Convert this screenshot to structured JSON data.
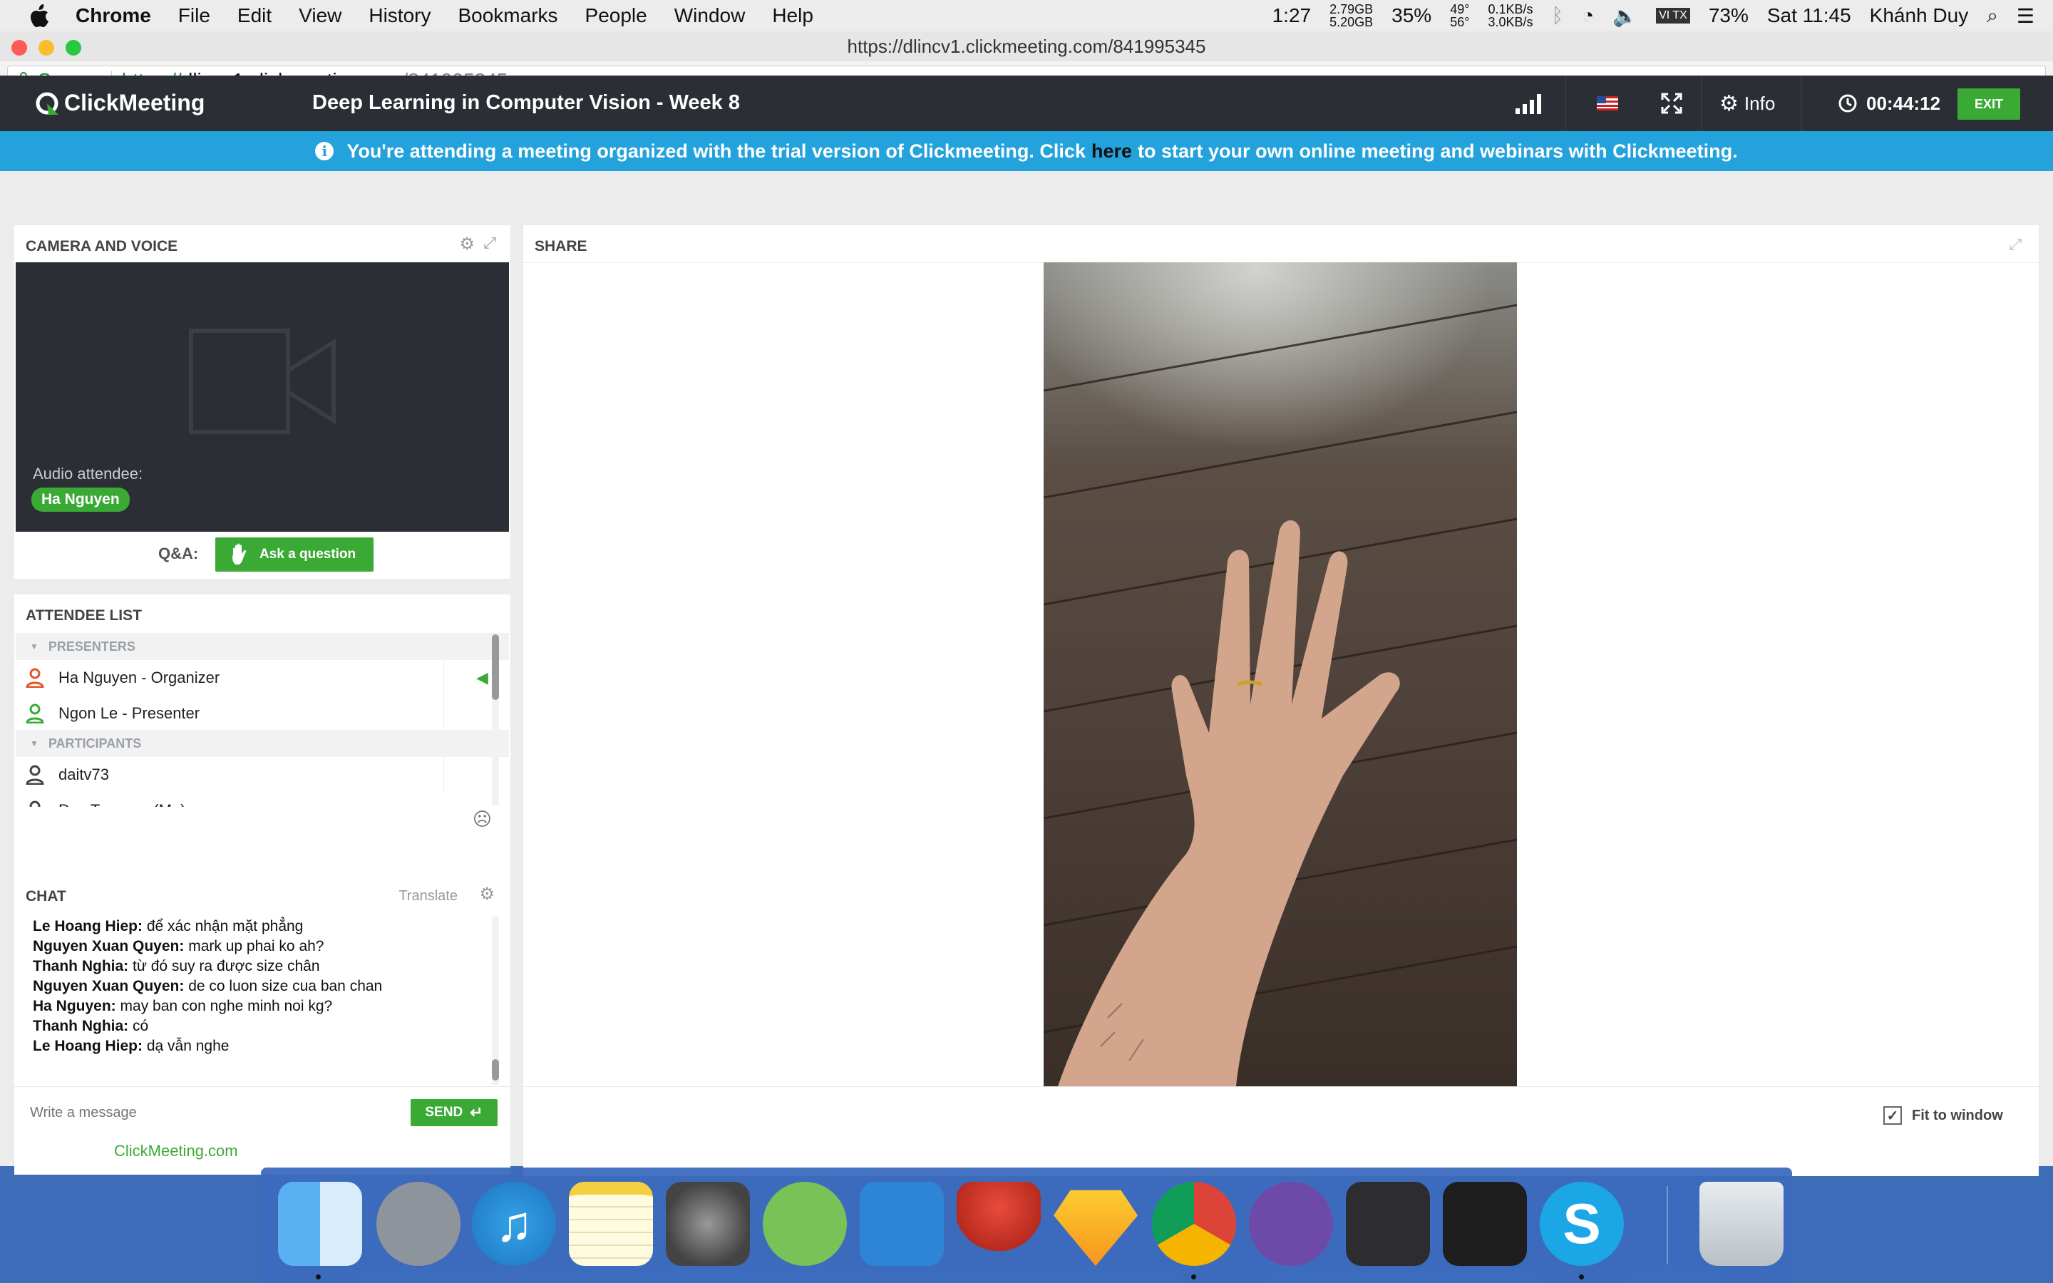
{
  "menubar": {
    "app": "Chrome",
    "items": [
      "File",
      "Edit",
      "View",
      "History",
      "Bookmarks",
      "People",
      "Window",
      "Help"
    ],
    "battery_time": "1:27",
    "mem_used": "2.79GB",
    "mem_free": "5.20GB",
    "cpu_percent": "35%",
    "temp_1": "49°",
    "temp_2": "56°",
    "net_up": "0.1KB/s",
    "net_down": "3.0KB/s",
    "input_source": "VI TX",
    "battery": "73%",
    "clock": "Sat 11:45",
    "user": "Khánh Duy"
  },
  "browser": {
    "window_title": "https://dlincv1.clickmeeting.com/841995345",
    "secure_label": "Secure",
    "url_scheme": "https://",
    "url_host": "dlincv1.clickmeeting.com",
    "url_path": "/841995345"
  },
  "header": {
    "logo": "ClickMeeting",
    "meeting_title": "Deep Learning in Computer Vision - Week 8",
    "info_label": "Info",
    "timer": "00:44:12",
    "exit_label": "EXIT"
  },
  "banner": {
    "text_before": "You're attending a meeting organized with the trial version of Clickmeeting. Click",
    "link": "here",
    "text_after": "to start your own online meeting and webinars with Clickmeeting."
  },
  "camera": {
    "title": "CAMERA AND VOICE",
    "audio_label": "Audio attendee:",
    "audio_name": "Ha Nguyen",
    "qa_label": "Q&A:",
    "ask_button": "Ask a question"
  },
  "attendees": {
    "title": "ATTENDEE LIST",
    "presenters_label": "PRESENTERS",
    "presenters": [
      {
        "name": "Ha Nguyen - Organizer",
        "color": "#e2572b"
      },
      {
        "name": "Ngon Le - Presenter",
        "color": "#3aaa35"
      }
    ],
    "participants_label": "PARTICIPANTS",
    "participants": [
      "daitv73",
      "Duy Truong - (Me)"
    ]
  },
  "chat": {
    "title": "CHAT",
    "translate": "Translate",
    "messages": [
      {
        "author": "Le Hoang Hiep:",
        "text": "để xác nhận mặt phẳng"
      },
      {
        "author": "Nguyen Xuan Quyen:",
        "text": "mark up phai ko ah?"
      },
      {
        "author": "Thanh Nghia:",
        "text": "từ đó suy ra được size chân"
      },
      {
        "author": "Nguyen Xuan Quyen:",
        "text": "de co luon size cua ban chan"
      },
      {
        "author": "Ha Nguyen:",
        "text": "may ban con nghe minh noi kg?"
      },
      {
        "author": "Thanh Nghia:",
        "text": "có"
      },
      {
        "author": "Le Hoang Hiep:",
        "text": "dạ vẫn nghe"
      }
    ],
    "placeholder": "Write a message",
    "send": "SEND"
  },
  "share": {
    "title": "SHARE",
    "fit_label": "Fit to window",
    "fit_checked": true
  },
  "footer": {
    "link": "ClickMeeting.com"
  },
  "colors": {
    "header_bg": "#2b2e35",
    "banner_bg": "#23a2dc",
    "accent_green": "#3aaa35"
  },
  "dock": [
    "finder-icon",
    "launchpad-icon",
    "itunes-icon",
    "notes-icon",
    "system-preferences-icon",
    "android-studio-icon",
    "xcode-icon",
    "instruments-icon",
    "sketch-icon",
    "chrome-icon",
    "github-desktop-icon",
    "visual-studio-icon",
    "vscode-icon",
    "skype-icon",
    "trash-icon"
  ]
}
